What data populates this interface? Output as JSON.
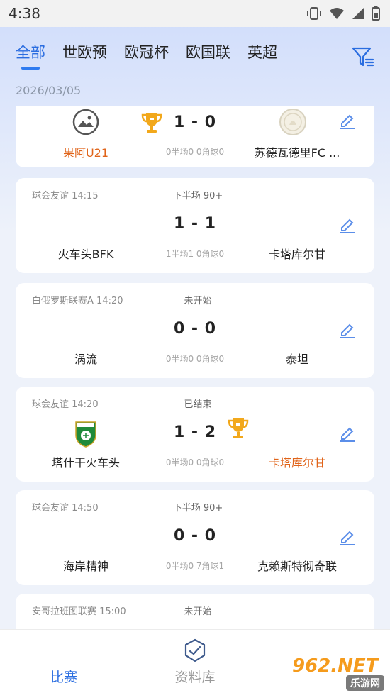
{
  "status_bar": {
    "time": "4:38"
  },
  "tabs": [
    "全部",
    "世欧预",
    "欧冠杯",
    "欧国联",
    "英超"
  ],
  "active_tab": 0,
  "date": "2026/03/05",
  "matches": [
    {
      "meta": "",
      "status": "",
      "score": "1 - 0",
      "sub": "0半场0 0角球0",
      "home": "果阿U21",
      "away": "苏德瓦德里FC ...",
      "winner": "home",
      "home_logo": "image-placeholder-icon",
      "away_logo": "club-crest-faded-icon"
    },
    {
      "meta": "球会友谊 14:15",
      "status": "下半场 90+",
      "score": "1 - 1",
      "sub": "1半场1 0角球0",
      "home": "火车头BFK",
      "away": "卡塔库尔甘",
      "winner": ""
    },
    {
      "meta": "白俄罗斯联赛A 14:20",
      "status": "未开始",
      "score": "0 - 0",
      "sub": "0半场0 0角球0",
      "home": "涡流",
      "away": "泰坦",
      "winner": ""
    },
    {
      "meta": "球会友谊 14:20",
      "status": "已结束",
      "score": "1 - 2",
      "sub": "0半场0 0角球0",
      "home": "塔什干火车头",
      "away": "卡塔库尔甘",
      "winner": "away",
      "home_logo": "green-shield-crest-icon"
    },
    {
      "meta": "球会友谊 14:50",
      "status": "下半场 90+",
      "score": "0 - 0",
      "sub": "0半场0 7角球1",
      "home": "海岸精神",
      "away": "克赖斯特彻奇联",
      "winner": ""
    },
    {
      "meta": "安哥拉班图联赛 15:00",
      "status": "未开始"
    }
  ],
  "bottom_nav": {
    "matches_label": "比赛",
    "library_label": "资料库"
  },
  "watermark": {
    "brand": "962.NET",
    "sub": "乐游网"
  },
  "colors": {
    "accent": "#2a6de0",
    "winner": "#e0641a",
    "trophy": "#f2a81b"
  }
}
